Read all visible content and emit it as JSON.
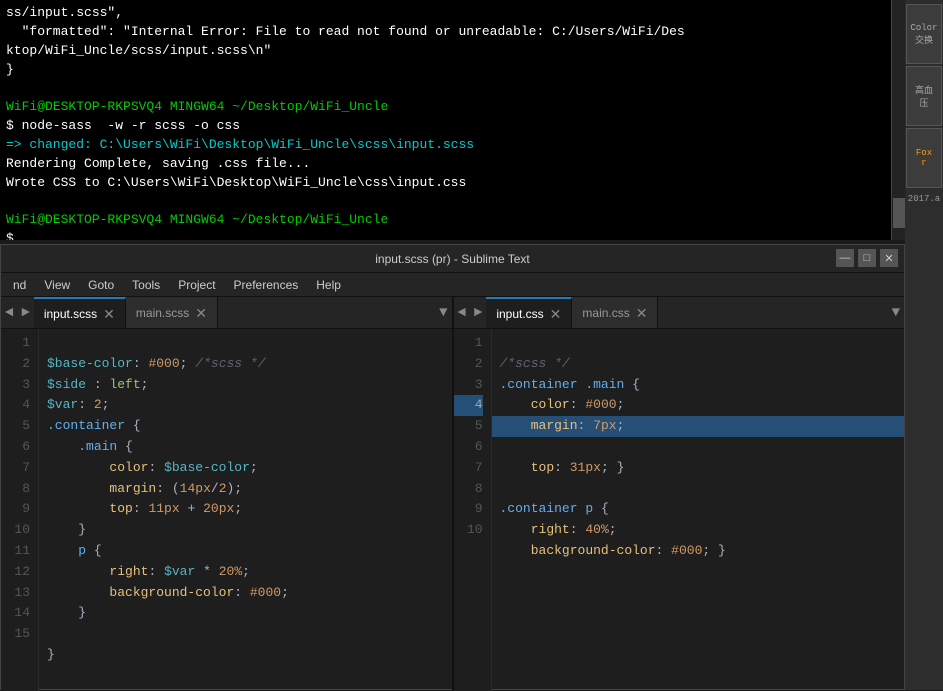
{
  "terminal": {
    "lines": [
      {
        "text": "ss/input.scss\",",
        "color": "white"
      },
      {
        "text": "  \"formatted\": \"Internal Error: File to read not found or unreadable: C:/Users/WiFi/Desktop/WiFi_Uncle/scss/input.scss\\n\"",
        "color": "white"
      },
      {
        "text": "}",
        "color": "white"
      },
      {
        "text": "",
        "color": "white"
      },
      {
        "text": "WiFi@DESKTOP-RKPSVQ4 MINGW64 ~/Desktop/WiFi_Uncle",
        "color": "green",
        "prompt": true
      },
      {
        "text": "$ node-sass  -w -r scss -o css",
        "color": "white",
        "dollar": true
      },
      {
        "text": "=> changed: C:\\Users\\WiFi\\Desktop\\WiFi_Uncle\\scss\\input.scss",
        "color": "cyan"
      },
      {
        "text": "Rendering Complete, saving .css file...",
        "color": "white"
      },
      {
        "text": "Wrote CSS to C:\\Users\\WiFi\\Desktop\\WiFi_Uncle\\css\\input.css",
        "color": "white"
      },
      {
        "text": "",
        "color": "white"
      },
      {
        "text": "WiFi@DESKTOP-RKPSVQ4 MINGW64 ~/Desktop/WiFi_Uncle",
        "color": "green",
        "prompt": true
      },
      {
        "text": "$ ",
        "color": "white",
        "dollar": true
      }
    ]
  },
  "sublime": {
    "title": "input.scss (pr) - Sublime Text",
    "menu": [
      "nd",
      "View",
      "Goto",
      "Tools",
      "Project",
      "Preferences",
      "Help"
    ],
    "left_tabs": [
      {
        "label": "input.scss",
        "active": true
      },
      {
        "label": "main.scss",
        "active": false
      }
    ],
    "right_tabs": [
      {
        "label": "input.css",
        "active": true
      },
      {
        "label": "main.css",
        "active": false
      }
    ],
    "left_code": [
      {
        "num": 1,
        "code": "$base-color: #000; /*scss */"
      },
      {
        "num": 2,
        "code": "$side : left;"
      },
      {
        "num": 3,
        "code": "$var: 2;"
      },
      {
        "num": 4,
        "code": ".container {"
      },
      {
        "num": 5,
        "code": "    .main {"
      },
      {
        "num": 6,
        "code": "        color: $base-color;"
      },
      {
        "num": 7,
        "code": "        margin: (14px/2);"
      },
      {
        "num": 8,
        "code": "        top: 11px + 20px;"
      },
      {
        "num": 9,
        "code": "    }"
      },
      {
        "num": 10,
        "code": "    p {"
      },
      {
        "num": 11,
        "code": "        right: $var * 20%;"
      },
      {
        "num": 12,
        "code": "        background-color: #000;"
      },
      {
        "num": 13,
        "code": "    }"
      },
      {
        "num": 14,
        "code": ""
      },
      {
        "num": 15,
        "code": "}"
      }
    ],
    "right_code": [
      {
        "num": 1,
        "code": "/*scss */"
      },
      {
        "num": 2,
        "code": ".container .main {"
      },
      {
        "num": 3,
        "code": "    color: #000;"
      },
      {
        "num": 4,
        "code": "    margin: 7px;",
        "highlighted": true
      },
      {
        "num": 5,
        "code": "    top: 31px; }"
      },
      {
        "num": 6,
        "code": ""
      },
      {
        "num": 7,
        "code": ".container p {"
      },
      {
        "num": 8,
        "code": "    right: 40%;"
      },
      {
        "num": 9,
        "code": "    background-color: #000; }"
      },
      {
        "num": 10,
        "code": ""
      }
    ]
  },
  "taskbar": {
    "items": [
      "Color\n交换",
      "高血\n压",
      "Fox\nr"
    ]
  },
  "icons": {
    "minimize": "—",
    "maximize": "□",
    "close": "✕",
    "nav_left": "◄",
    "nav_right": "►",
    "dropdown": "▼"
  }
}
